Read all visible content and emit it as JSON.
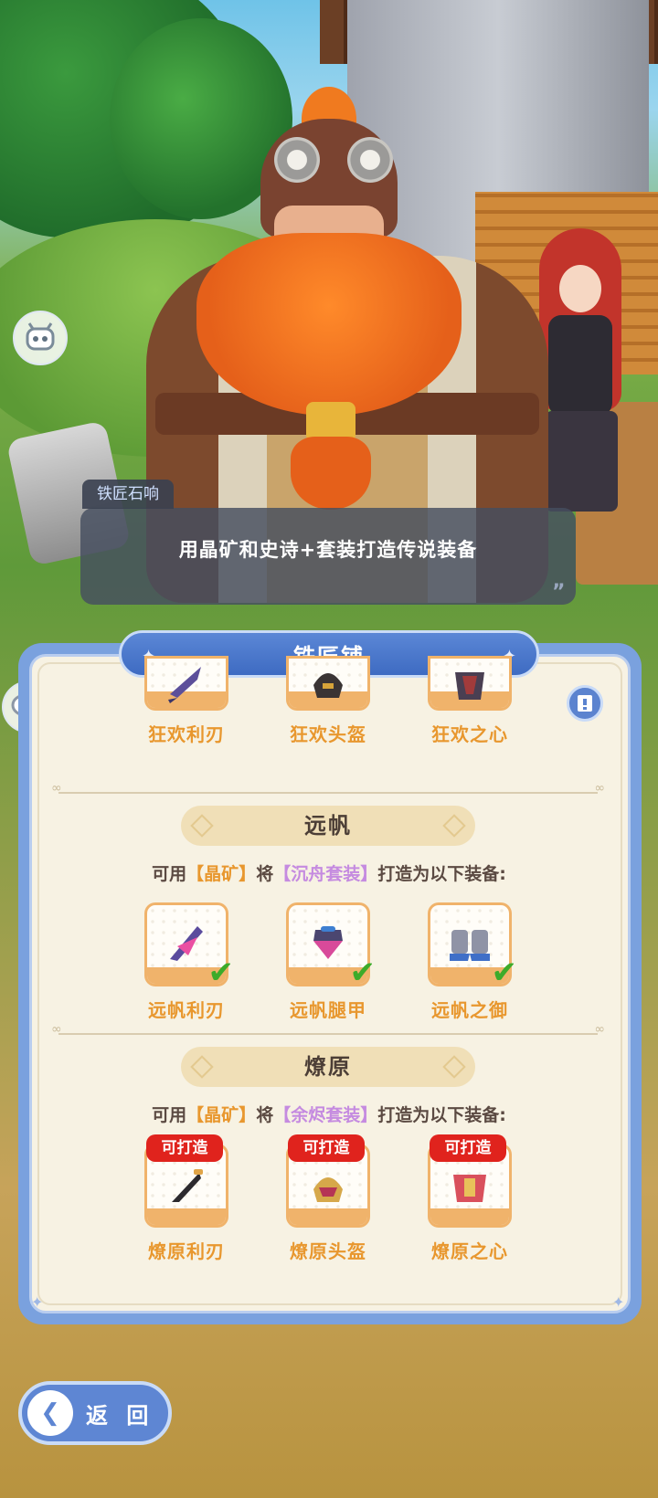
{
  "dialogue": {
    "speaker": "铁匠石响",
    "text": "用晶矿和史诗+套装打造传说装备",
    "end_mark": "”"
  },
  "panel": {
    "title": "铁匠铺",
    "help_icon": "book-icon"
  },
  "top_row": [
    {
      "name": "狂欢利刃",
      "icon": "blade-icon"
    },
    {
      "name": "狂欢头盔",
      "icon": "helmet-icon"
    },
    {
      "name": "狂欢之心",
      "icon": "armor-icon"
    }
  ],
  "sections": [
    {
      "title": "远帆",
      "instr_prefix": "可用",
      "material": "【晶矿】",
      "instr_mid": "将",
      "set_name": "【沉舟套装】",
      "instr_suffix": "打造为以下装备:",
      "items": [
        {
          "name": "远帆利刃",
          "icon": "blade-icon",
          "status": "owned"
        },
        {
          "name": "远帆腿甲",
          "icon": "leg-armor-icon",
          "status": "owned"
        },
        {
          "name": "远帆之御",
          "icon": "boots-icon",
          "status": "owned"
        }
      ]
    },
    {
      "title": "燎原",
      "instr_prefix": "可用",
      "material": "【晶矿】",
      "instr_mid": "将",
      "set_name": "【余烬套装】",
      "instr_suffix": "打造为以下装备:",
      "items": [
        {
          "name": "燎原利刃",
          "icon": "blade-icon",
          "badge": "可打造"
        },
        {
          "name": "燎原头盔",
          "icon": "helmet-icon",
          "badge": "可打造"
        },
        {
          "name": "燎原之心",
          "icon": "armor-icon",
          "badge": "可打造"
        }
      ]
    }
  ],
  "back_button": {
    "label": "返 回"
  },
  "colors": {
    "panel_blue": "#7aa1de",
    "item_name": "#e8972e",
    "set_name": "#c58be0",
    "badge_red": "#e0231d",
    "check_green": "#3dab2a"
  }
}
